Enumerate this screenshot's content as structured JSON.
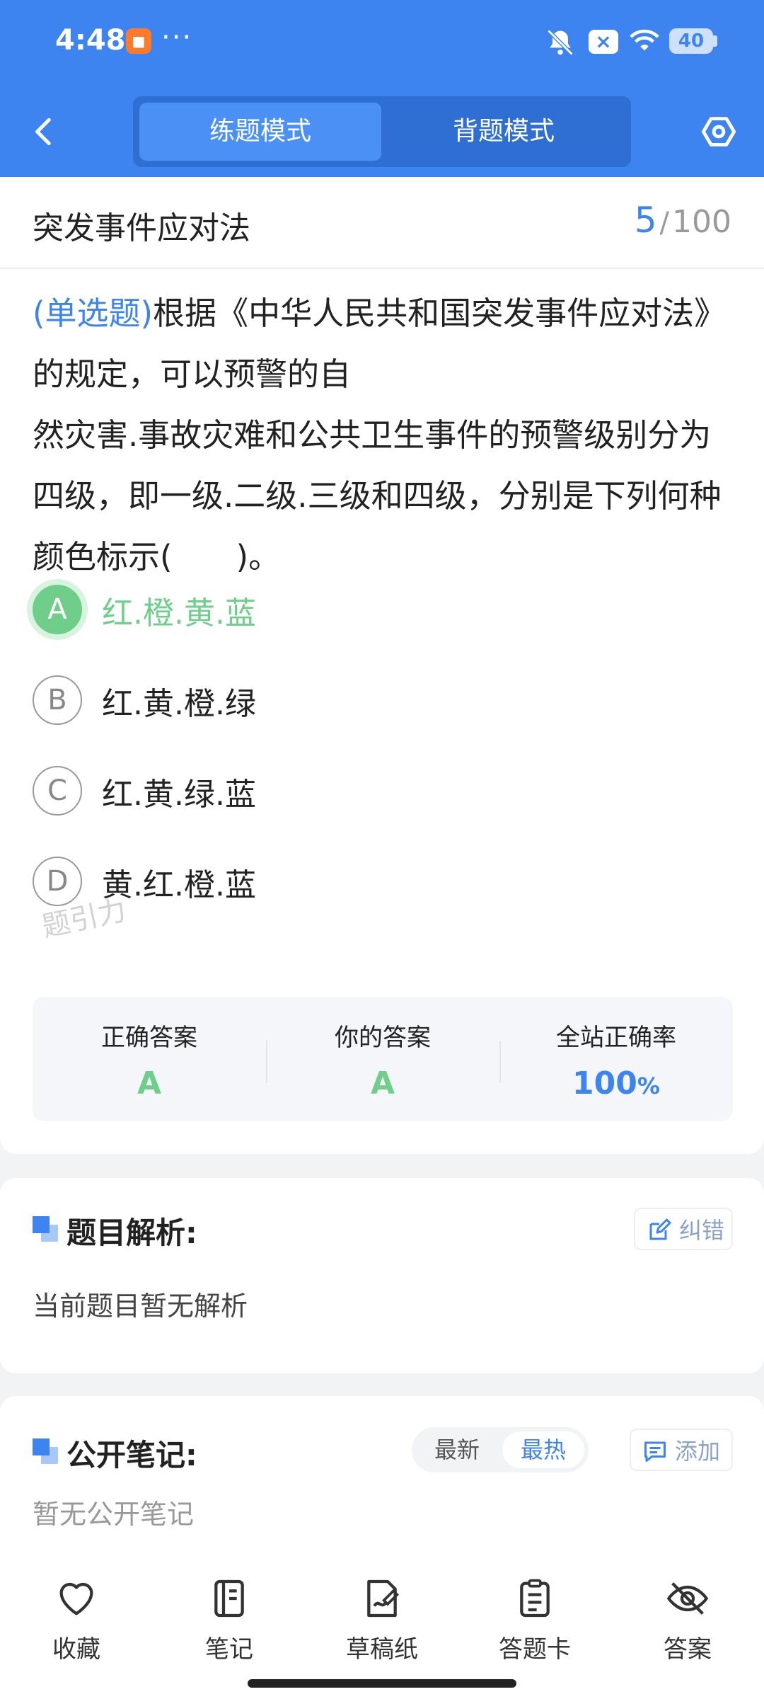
{
  "status_bar": {
    "time": "4:48",
    "battery": "40",
    "more": "···"
  },
  "header": {
    "tabs": [
      {
        "label": "练题模式",
        "active": true
      },
      {
        "label": "背题模式",
        "active": false
      }
    ]
  },
  "subject": {
    "title": "突发事件应对法",
    "current": "5",
    "total": "100",
    "separator": "/"
  },
  "question": {
    "type_label": "(单选题)",
    "line1": "根据《中华人民共和国突发事件应对法》的规定，可以预警的自",
    "line2": "然灾害.事故灾难和公共卫生事件的预警级别分为四级，即一级.二级.三级和四级，分别是下列何种颜色标示(　　)。"
  },
  "options": [
    {
      "letter": "A",
      "text": "红.橙.黄.蓝",
      "correct": true
    },
    {
      "letter": "B",
      "text": "红.黄.橙.绿",
      "correct": false
    },
    {
      "letter": "C",
      "text": "红.黄.绿.蓝",
      "correct": false
    },
    {
      "letter": "D",
      "text": "黄.红.橙.蓝",
      "correct": false
    }
  ],
  "watermark": "题引力",
  "answer_summary": {
    "correct_label": "正确答案",
    "correct_value": "A",
    "yours_label": "你的答案",
    "yours_value": "A",
    "rate_label": "全站正确率",
    "rate_value": "100",
    "rate_unit": "%"
  },
  "analysis": {
    "title": "题目解析:",
    "report_label": "纠错",
    "empty_text": "当前题目暂无解析"
  },
  "notes": {
    "title": "公开笔记:",
    "sort_latest": "最新",
    "sort_hot": "最热",
    "add_label": "添加",
    "empty_text": "暂无公开笔记"
  },
  "bottom_nav": [
    {
      "label": "收藏",
      "icon": "heart-icon"
    },
    {
      "label": "笔记",
      "icon": "notebook-icon"
    },
    {
      "label": "草稿纸",
      "icon": "draft-paper-icon"
    },
    {
      "label": "答题卡",
      "icon": "answer-sheet-icon"
    },
    {
      "label": "答案",
      "icon": "eye-off-icon"
    }
  ],
  "colors": {
    "primary": "#3d84f0",
    "correct": "#6fcf8a",
    "background": "#f2f3f5"
  }
}
